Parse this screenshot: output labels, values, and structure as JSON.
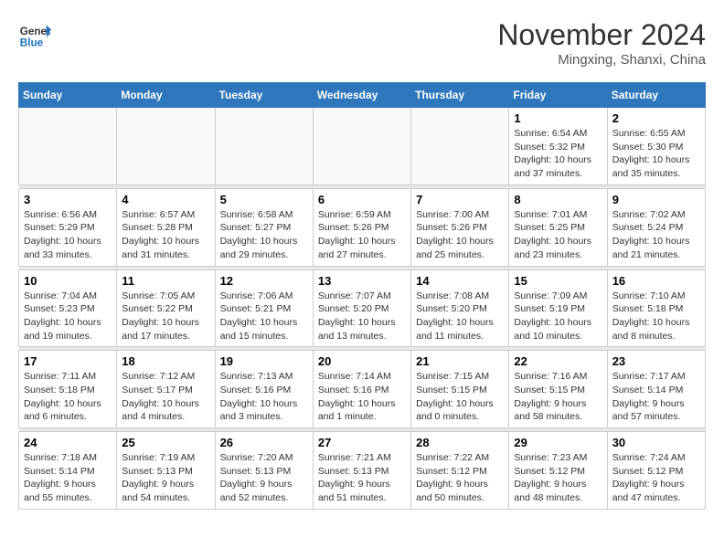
{
  "header": {
    "logo_line1": "General",
    "logo_line2": "Blue",
    "month_title": "November 2024",
    "subtitle": "Mingxing, Shanxi, China"
  },
  "days_of_week": [
    "Sunday",
    "Monday",
    "Tuesday",
    "Wednesday",
    "Thursday",
    "Friday",
    "Saturday"
  ],
  "weeks": [
    {
      "days": [
        {
          "number": "",
          "info": ""
        },
        {
          "number": "",
          "info": ""
        },
        {
          "number": "",
          "info": ""
        },
        {
          "number": "",
          "info": ""
        },
        {
          "number": "",
          "info": ""
        },
        {
          "number": "1",
          "info": "Sunrise: 6:54 AM\nSunset: 5:32 PM\nDaylight: 10 hours\nand 37 minutes."
        },
        {
          "number": "2",
          "info": "Sunrise: 6:55 AM\nSunset: 5:30 PM\nDaylight: 10 hours\nand 35 minutes."
        }
      ]
    },
    {
      "days": [
        {
          "number": "3",
          "info": "Sunrise: 6:56 AM\nSunset: 5:29 PM\nDaylight: 10 hours\nand 33 minutes."
        },
        {
          "number": "4",
          "info": "Sunrise: 6:57 AM\nSunset: 5:28 PM\nDaylight: 10 hours\nand 31 minutes."
        },
        {
          "number": "5",
          "info": "Sunrise: 6:58 AM\nSunset: 5:27 PM\nDaylight: 10 hours\nand 29 minutes."
        },
        {
          "number": "6",
          "info": "Sunrise: 6:59 AM\nSunset: 5:26 PM\nDaylight: 10 hours\nand 27 minutes."
        },
        {
          "number": "7",
          "info": "Sunrise: 7:00 AM\nSunset: 5:26 PM\nDaylight: 10 hours\nand 25 minutes."
        },
        {
          "number": "8",
          "info": "Sunrise: 7:01 AM\nSunset: 5:25 PM\nDaylight: 10 hours\nand 23 minutes."
        },
        {
          "number": "9",
          "info": "Sunrise: 7:02 AM\nSunset: 5:24 PM\nDaylight: 10 hours\nand 21 minutes."
        }
      ]
    },
    {
      "days": [
        {
          "number": "10",
          "info": "Sunrise: 7:04 AM\nSunset: 5:23 PM\nDaylight: 10 hours\nand 19 minutes."
        },
        {
          "number": "11",
          "info": "Sunrise: 7:05 AM\nSunset: 5:22 PM\nDaylight: 10 hours\nand 17 minutes."
        },
        {
          "number": "12",
          "info": "Sunrise: 7:06 AM\nSunset: 5:21 PM\nDaylight: 10 hours\nand 15 minutes."
        },
        {
          "number": "13",
          "info": "Sunrise: 7:07 AM\nSunset: 5:20 PM\nDaylight: 10 hours\nand 13 minutes."
        },
        {
          "number": "14",
          "info": "Sunrise: 7:08 AM\nSunset: 5:20 PM\nDaylight: 10 hours\nand 11 minutes."
        },
        {
          "number": "15",
          "info": "Sunrise: 7:09 AM\nSunset: 5:19 PM\nDaylight: 10 hours\nand 10 minutes."
        },
        {
          "number": "16",
          "info": "Sunrise: 7:10 AM\nSunset: 5:18 PM\nDaylight: 10 hours\nand 8 minutes."
        }
      ]
    },
    {
      "days": [
        {
          "number": "17",
          "info": "Sunrise: 7:11 AM\nSunset: 5:18 PM\nDaylight: 10 hours\nand 6 minutes."
        },
        {
          "number": "18",
          "info": "Sunrise: 7:12 AM\nSunset: 5:17 PM\nDaylight: 10 hours\nand 4 minutes."
        },
        {
          "number": "19",
          "info": "Sunrise: 7:13 AM\nSunset: 5:16 PM\nDaylight: 10 hours\nand 3 minutes."
        },
        {
          "number": "20",
          "info": "Sunrise: 7:14 AM\nSunset: 5:16 PM\nDaylight: 10 hours\nand 1 minute."
        },
        {
          "number": "21",
          "info": "Sunrise: 7:15 AM\nSunset: 5:15 PM\nDaylight: 10 hours\nand 0 minutes."
        },
        {
          "number": "22",
          "info": "Sunrise: 7:16 AM\nSunset: 5:15 PM\nDaylight: 9 hours\nand 58 minutes."
        },
        {
          "number": "23",
          "info": "Sunrise: 7:17 AM\nSunset: 5:14 PM\nDaylight: 9 hours\nand 57 minutes."
        }
      ]
    },
    {
      "days": [
        {
          "number": "24",
          "info": "Sunrise: 7:18 AM\nSunset: 5:14 PM\nDaylight: 9 hours\nand 55 minutes."
        },
        {
          "number": "25",
          "info": "Sunrise: 7:19 AM\nSunset: 5:13 PM\nDaylight: 9 hours\nand 54 minutes."
        },
        {
          "number": "26",
          "info": "Sunrise: 7:20 AM\nSunset: 5:13 PM\nDaylight: 9 hours\nand 52 minutes."
        },
        {
          "number": "27",
          "info": "Sunrise: 7:21 AM\nSunset: 5:13 PM\nDaylight: 9 hours\nand 51 minutes."
        },
        {
          "number": "28",
          "info": "Sunrise: 7:22 AM\nSunset: 5:12 PM\nDaylight: 9 hours\nand 50 minutes."
        },
        {
          "number": "29",
          "info": "Sunrise: 7:23 AM\nSunset: 5:12 PM\nDaylight: 9 hours\nand 48 minutes."
        },
        {
          "number": "30",
          "info": "Sunrise: 7:24 AM\nSunset: 5:12 PM\nDaylight: 9 hours\nand 47 minutes."
        }
      ]
    }
  ]
}
